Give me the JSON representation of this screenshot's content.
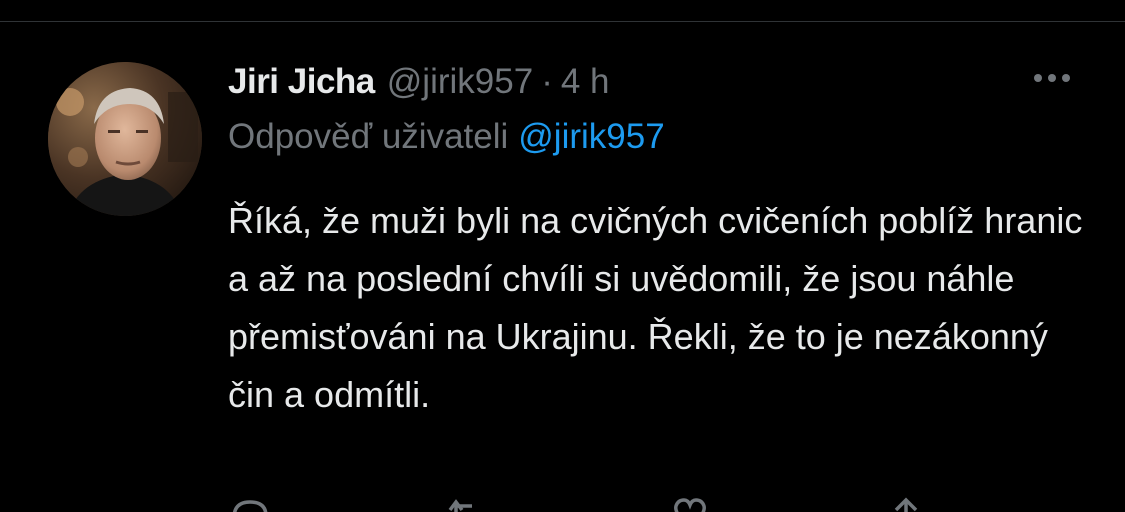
{
  "tweet": {
    "author": {
      "display_name": "Jiri Jicha",
      "handle": "@jirik957"
    },
    "separator": "·",
    "time": "4 h",
    "reply_to": {
      "prefix": "Odpověď uživateli",
      "mention": "@jirik957"
    },
    "text": "Říká, že muži byli na cvičných cvičeních poblíž hranic a až na poslední chvíli si uvědomili, že jsou náhle přemisťováni na Ukrajinu. Řekli, že to je nezákonný čin a odmítli."
  },
  "icons": {
    "more": "more-horizontal-icon",
    "reply": "reply-icon",
    "retweet": "retweet-icon",
    "like": "heart-icon",
    "share": "share-icon"
  },
  "colors": {
    "background": "#000000",
    "text_primary": "#e7e9ea",
    "text_secondary": "#71767b",
    "accent": "#1d9bf0",
    "divider": "#2f3336"
  }
}
